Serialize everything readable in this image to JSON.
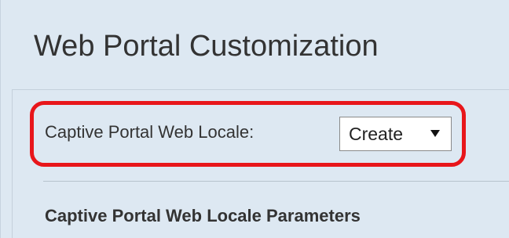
{
  "header": {
    "title": "Web Portal Customization"
  },
  "locale": {
    "label": "Captive Portal Web Locale:",
    "selected_value": "Create",
    "arrow_icon": "triangle-down-icon"
  },
  "section": {
    "heading": "Captive Portal Web Locale Parameters"
  },
  "colors": {
    "panel_background": "#dde8f2",
    "highlight": "#e8161b",
    "text": "#333333"
  }
}
